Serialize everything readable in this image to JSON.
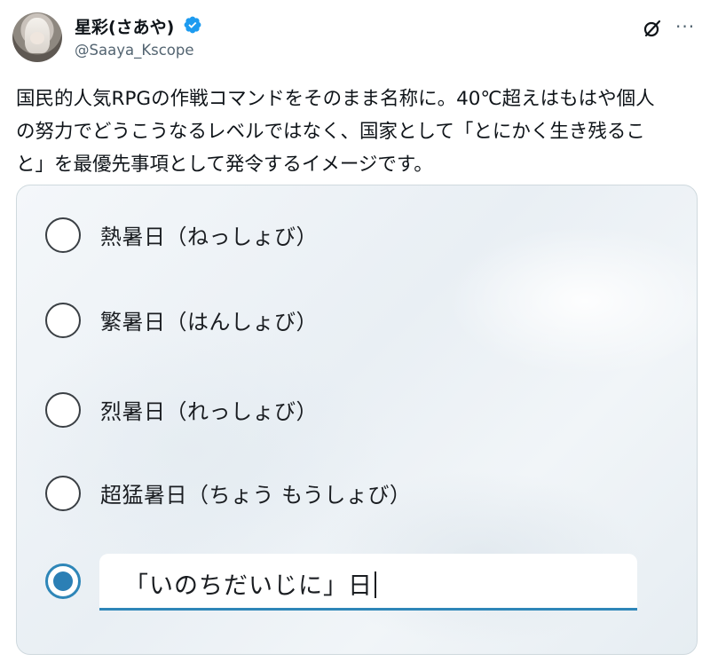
{
  "author": {
    "display_name": "星彩(さあや)",
    "handle": "@Saaya_Kscope",
    "verified": true,
    "verified_color": "#1d9bf0"
  },
  "header_icons": [
    "grok-icon",
    "more-icon"
  ],
  "tweet": {
    "text_lines": [
      "国民的人気RPGの作戦コマンドをそのまま名称に。40℃超えはもはや個人",
      "の努力でどうこうなるレベルではなく、国家として「とにかく生き残るこ",
      "と」を最優先事項として発令するイメージです。"
    ]
  },
  "media": {
    "options": [
      {
        "label": "熱暑日（ねっしょび）",
        "selected": false
      },
      {
        "label": "繁暑日（はんしょび）",
        "selected": false
      },
      {
        "label": "烈暑日（れっしょび）",
        "selected": false
      },
      {
        "label": "超猛暑日（ちょう もうしょび）",
        "selected": false
      }
    ],
    "custom_option": {
      "selected": true,
      "value": "「いのちだいじに」日"
    },
    "accent_color": "#2b7fb5"
  }
}
